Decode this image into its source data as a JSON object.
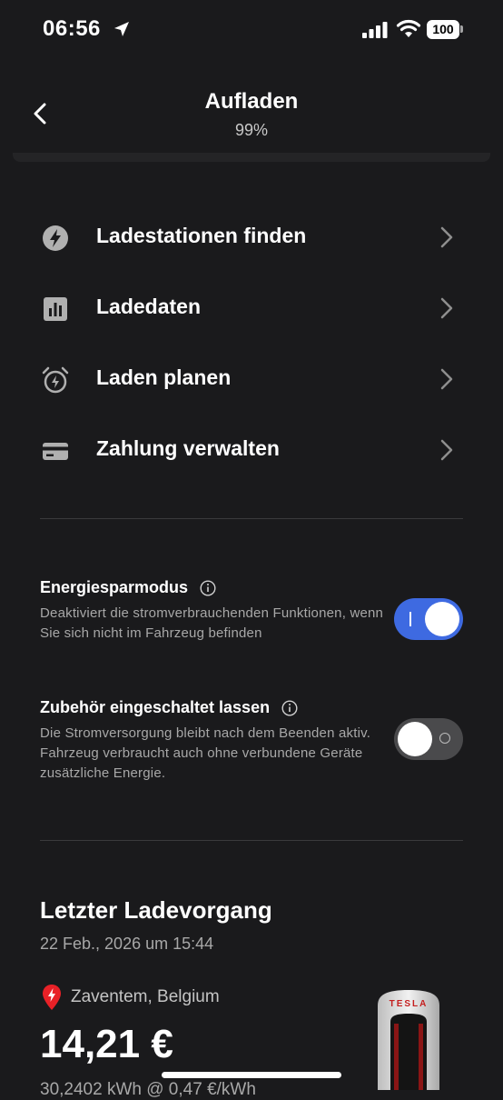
{
  "status_bar": {
    "time": "06:56",
    "battery": "100"
  },
  "header": {
    "title": "Aufladen",
    "subtitle": "99%"
  },
  "menu": {
    "items": [
      {
        "label": "Ladestationen finden",
        "icon": "bolt-circle-icon"
      },
      {
        "label": "Ladedaten",
        "icon": "bar-chart-icon"
      },
      {
        "label": "Laden planen",
        "icon": "alarm-clock-icon"
      },
      {
        "label": "Zahlung verwalten",
        "icon": "credit-card-icon"
      }
    ]
  },
  "settings": {
    "energy_saving": {
      "title": "Energiesparmodus",
      "description": "Deaktiviert die stromverbrauchenden Funktionen, wenn Sie sich nicht im Fahrzeug befinden",
      "enabled": true
    },
    "accessory_power": {
      "title": "Zubehör eingeschaltet lassen",
      "description": "Die Stromversorgung bleibt nach dem Beenden aktiv. Fahrzeug verbraucht auch ohne verbundene Geräte zusätzliche Energie.",
      "enabled": false
    }
  },
  "last_session": {
    "title": "Letzter Ladevorgang",
    "date": "22 Feb., 2026 um 15:44",
    "location": "Zaventem, Belgium",
    "price": "14,21 €",
    "energy": "30,2402 kWh @ 0,47 €/kWh",
    "charger_brand": "TESLA"
  },
  "colors": {
    "accent": "#3e6ae1",
    "background": "#1a1a1c",
    "pin": "#e82127"
  }
}
